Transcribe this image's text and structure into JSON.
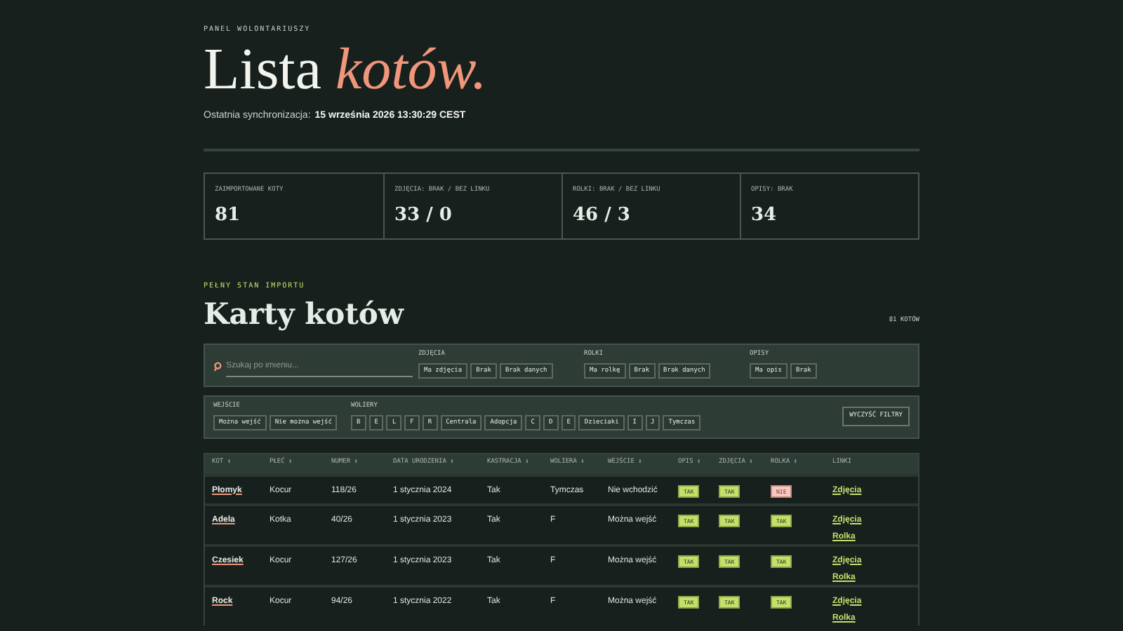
{
  "header": {
    "eyebrow": "PANEL WOLONTARIUSZY",
    "title_main": "Lista",
    "title_accent": "kotów.",
    "sync_label": "Ostatnia synchronizacja:",
    "sync_value": "15 września 2026 13:30:29 CEST"
  },
  "stats": [
    {
      "label": "ZAIMPORTOWANE KOTY",
      "value": "81"
    },
    {
      "label": "ZDJĘCIA: BRAK / BEZ LINKU",
      "value": "33 / 0"
    },
    {
      "label": "ROLKI: BRAK / BEZ LINKU",
      "value": "46 / 3"
    },
    {
      "label": "OPISY: BRAK",
      "value": "34"
    }
  ],
  "section": {
    "eyebrow": "PEŁNY STAN IMPORTU",
    "title": "Karty kotów",
    "count": "81 KOTÓW"
  },
  "search": {
    "placeholder": "Szukaj po imieniu..."
  },
  "filter_groups_top": [
    {
      "label": "ZDJĘCIA",
      "options": [
        "Ma zdjęcia",
        "Brak",
        "Brak danych"
      ]
    },
    {
      "label": "ROLKI",
      "options": [
        "Ma rolkę",
        "Brak",
        "Brak danych"
      ]
    },
    {
      "label": "OPISY",
      "options": [
        "Ma opis",
        "Brak"
      ]
    }
  ],
  "filter_groups_bottom": [
    {
      "label": "WEJŚCIE",
      "options": [
        "Można wejść",
        "Nie można wejść"
      ]
    },
    {
      "label": "WOLIERY",
      "options": [
        "B",
        "E",
        "L",
        "F",
        "R",
        "Centrala",
        "Adopcja",
        "C",
        "D",
        "E",
        "Dzieciaki",
        "I",
        "J",
        "Tymczas"
      ]
    }
  ],
  "clear_button": "WYCZYŚĆ FILTRY",
  "table": {
    "columns": [
      "KOT ↕",
      "PŁEĆ ↕",
      "NUMER ↕",
      "DATA URODZENIA ↕",
      "KASTRACJA ↕",
      "WOLIERA ↕",
      "WEJŚCIE ↕",
      "OPIS ↕",
      "ZDJĘCIA ↕",
      "ROLKA ↕",
      "LINKI"
    ],
    "rows": [
      {
        "name": "Płomyk",
        "sex": "Kocur",
        "number": "118/26",
        "birth": "1 stycznia 2024",
        "neutered": "Tak",
        "enclosure": "Tymczas",
        "entry": "Nie wchodzić",
        "flags": [
          {
            "text": "TAK",
            "ok": true
          },
          {
            "text": "TAK",
            "ok": true
          },
          {
            "text": "NIE",
            "ok": false
          }
        ],
        "links": [
          "Zdjęcia"
        ]
      },
      {
        "name": "Adela",
        "sex": "Kotka",
        "number": "40/26",
        "birth": "1 stycznia 2023",
        "neutered": "Tak",
        "enclosure": "F",
        "entry": "Można wejść",
        "flags": [
          {
            "text": "TAK",
            "ok": true
          },
          {
            "text": "TAK",
            "ok": true
          },
          {
            "text": "TAK",
            "ok": true
          }
        ],
        "links": [
          "Zdjęcia",
          "Rolka"
        ]
      },
      {
        "name": "Czesiek",
        "sex": "Kocur",
        "number": "127/26",
        "birth": "1 stycznia 2023",
        "neutered": "Tak",
        "enclosure": "F",
        "entry": "Można wejść",
        "flags": [
          {
            "text": "TAK",
            "ok": true
          },
          {
            "text": "TAK",
            "ok": true
          },
          {
            "text": "TAK",
            "ok": true
          }
        ],
        "links": [
          "Zdjęcia",
          "Rolka"
        ]
      },
      {
        "name": "Rock",
        "sex": "Kocur",
        "number": "94/26",
        "birth": "1 stycznia 2022",
        "neutered": "Tak",
        "enclosure": "F",
        "entry": "Można wejść",
        "flags": [
          {
            "text": "TAK",
            "ok": true
          },
          {
            "text": "TAK",
            "ok": true
          },
          {
            "text": "TAK",
            "ok": true
          }
        ],
        "links": [
          "Zdjęcia",
          "Rolka"
        ]
      }
    ]
  }
}
